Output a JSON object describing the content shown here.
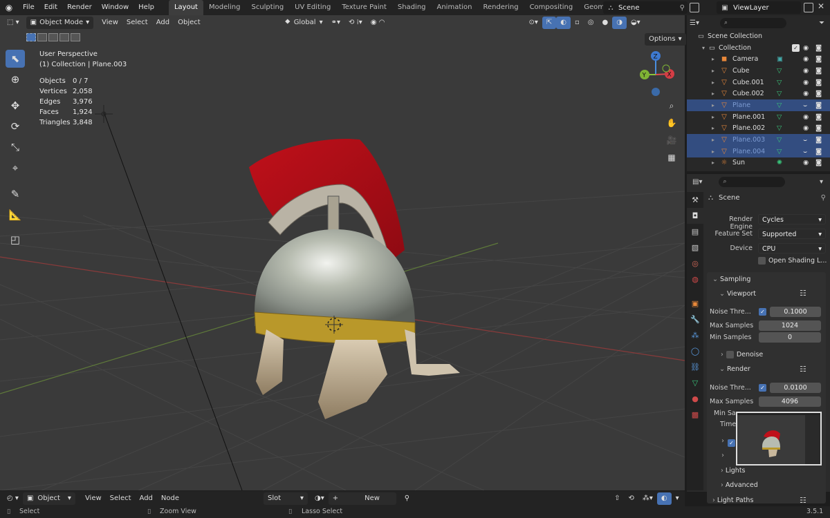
{
  "topbar": {
    "menus": [
      "File",
      "Edit",
      "Render",
      "Window",
      "Help"
    ],
    "workspaces": [
      "Layout",
      "Modeling",
      "Sculpting",
      "UV Editing",
      "Texture Paint",
      "Shading",
      "Animation",
      "Rendering",
      "Compositing",
      "Geometry Nodes"
    ],
    "active_workspace": "Layout",
    "scene": "Scene",
    "view_layer": "ViewLayer"
  },
  "viewport_header": {
    "mode": "Object Mode",
    "menus": [
      "View",
      "Select",
      "Add",
      "Object"
    ],
    "transform": "Global",
    "options": "Options"
  },
  "overlay": {
    "view_name": "User Perspective",
    "collection": "(1) Collection | Plane.003",
    "stats": [
      {
        "label": "Objects",
        "value": "0 / 7"
      },
      {
        "label": "Vertices",
        "value": "2,058"
      },
      {
        "label": "Edges",
        "value": "3,976"
      },
      {
        "label": "Faces",
        "value": "1,924"
      },
      {
        "label": "Triangles",
        "value": "3,848"
      }
    ]
  },
  "gizmo": {
    "x": "X",
    "y": "Y",
    "z": "Z"
  },
  "outliner": {
    "root": "Scene Collection",
    "collection": "Collection",
    "items": [
      {
        "name": "Camera",
        "icon": "camera-icon",
        "selected": false,
        "dim": false
      },
      {
        "name": "Cube",
        "icon": "mesh-icon",
        "selected": false,
        "dim": false
      },
      {
        "name": "Cube.001",
        "icon": "mesh-icon",
        "selected": false,
        "dim": false
      },
      {
        "name": "Cube.002",
        "icon": "mesh-icon",
        "selected": false,
        "dim": false
      },
      {
        "name": "Plane",
        "icon": "mesh-icon",
        "selected": true,
        "dim": true
      },
      {
        "name": "Plane.001",
        "icon": "mesh-icon",
        "selected": false,
        "dim": false
      },
      {
        "name": "Plane.002",
        "icon": "mesh-icon",
        "selected": false,
        "dim": false
      },
      {
        "name": "Plane.003",
        "icon": "mesh-icon",
        "selected": true,
        "dim": true
      },
      {
        "name": "Plane.004",
        "icon": "mesh-icon",
        "selected": true,
        "dim": true
      },
      {
        "name": "Sun",
        "icon": "light-icon",
        "selected": false,
        "dim": false
      }
    ]
  },
  "properties": {
    "context": "Scene",
    "render_engine_label": "Render Engine",
    "render_engine": "Cycles",
    "feature_set_label": "Feature Set",
    "feature_set": "Supported",
    "device_label": "Device",
    "device": "CPU",
    "open_shading": "Open Shading L...",
    "sampling": "Sampling",
    "viewport": "Viewport",
    "noise_label": "Noise Thre...",
    "viewport_noise": "0.1000",
    "max_samples_label": "Max Samples",
    "viewport_max": "1024",
    "min_samples_label": "Min Samples",
    "viewport_min": "0",
    "denoise": "Denoise",
    "render": "Render",
    "render_noise": "0.0100",
    "render_max": "4096",
    "render_min_label": "Min Sa",
    "time_label": "Time",
    "lights": "Lights",
    "advanced": "Advanced",
    "light_paths": "Light Paths"
  },
  "timeline": {
    "editor": "Object",
    "menus": [
      "View",
      "Select",
      "Add",
      "Node"
    ],
    "slot": "Slot",
    "new_label": "New"
  },
  "statusbar": {
    "select": "Select",
    "zoom": "Zoom View",
    "lasso": "Lasso Select",
    "version": "3.5.1"
  }
}
